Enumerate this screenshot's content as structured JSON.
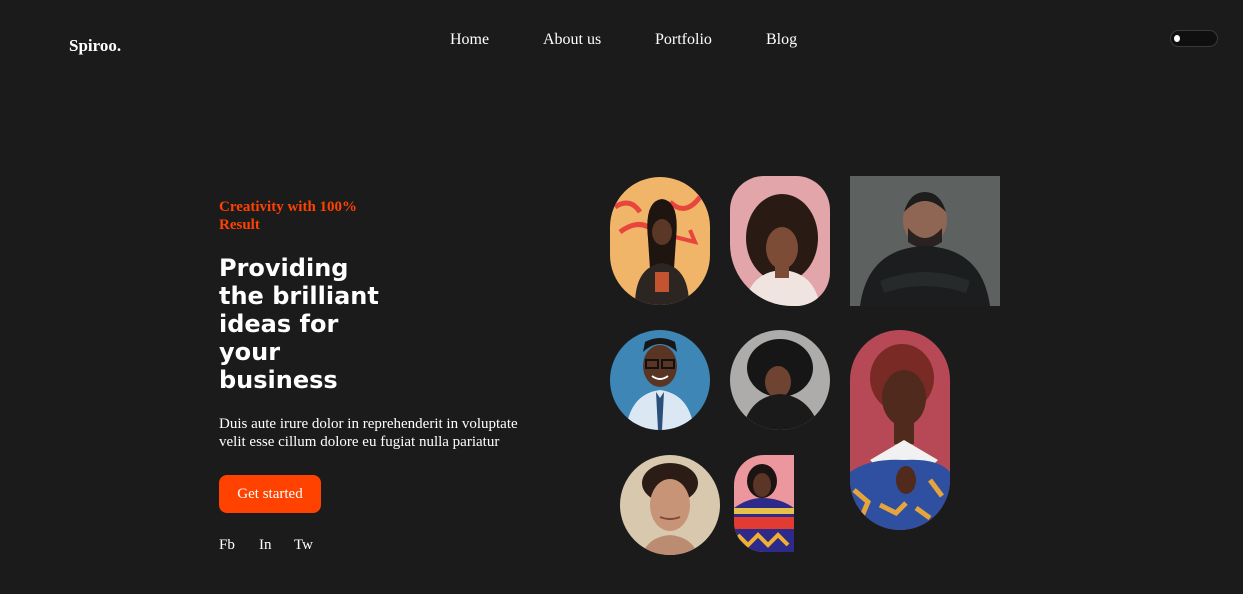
{
  "brand": {
    "logo": "Spiroo."
  },
  "nav": {
    "items": [
      {
        "label": "Home"
      },
      {
        "label": "About us"
      },
      {
        "label": "Portfolio"
      },
      {
        "label": "Blog"
      }
    ]
  },
  "theme_toggle": {
    "state": "off"
  },
  "hero": {
    "tagline": "Creativity with 100% Result",
    "headline": "Providing the brilliant ideas for your business",
    "description": "Duis aute irure dolor in reprehenderit in voluptate velit esse cillum dolore eu fugiat nulla pariatur",
    "cta_label": "Get started",
    "accent_color": "#ff4200"
  },
  "social": {
    "links": [
      {
        "label": "Fb"
      },
      {
        "label": "In"
      },
      {
        "label": "Tw"
      }
    ]
  },
  "gallery": {
    "photos": [
      {
        "subject": "woman with braids in front of graffiti wall"
      },
      {
        "subject": "woman with curly hair on pink background"
      },
      {
        "subject": "man in black hoodie with arms crossed"
      },
      {
        "subject": "smiling man with glasses on blue background"
      },
      {
        "subject": "woman with afro on grey background"
      },
      {
        "subject": "woman with short red hair and patterned top"
      },
      {
        "subject": "young man with curly hair"
      },
      {
        "subject": "woman in patterned dress on pink background"
      }
    ]
  }
}
